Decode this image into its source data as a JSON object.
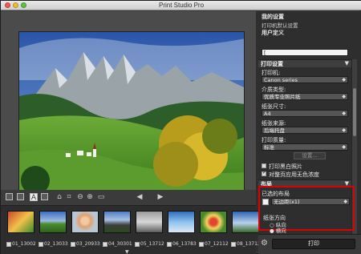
{
  "window": {
    "title": "Print Studio Pro"
  },
  "panel": {
    "my_settings": {
      "header": "我的设置",
      "item_default": "打印机默认设置",
      "item_user": "用户定义",
      "search_value": "["
    },
    "print_settings": {
      "header": "打印设置",
      "printer_label": "打印机:",
      "printer_value": "Canon                    series",
      "media_type_label": "介质类型:",
      "media_type_value": "优质专业照片纸",
      "paper_size_label": "纸张尺寸:",
      "paper_size_value": "A4",
      "paper_source_label": "纸张来源:",
      "paper_source_value": "后端托盘",
      "quality_label": "打印质量:",
      "quality_value": "标准",
      "settings_button": "设置...",
      "bw_print_label": "打印黑白照片",
      "color_correction_label": "对整页应用无色浓度",
      "bw_print_checked": false,
      "color_correction_checked": true
    },
    "layout": {
      "header": "布局",
      "selected_label": "已选的布局",
      "layout_value": "无边距(x1)",
      "orientation_label": "纸张方向",
      "portrait_label": "纵向",
      "landscape_label": "横向",
      "selected_orientation": "landscape"
    },
    "print_button": "打印"
  },
  "thumbnails": [
    {
      "name": "01_13002",
      "checked": true
    },
    {
      "name": "02_13033",
      "checked": true
    },
    {
      "name": "03_20933",
      "checked": true
    },
    {
      "name": "04_30301",
      "checked": true
    },
    {
      "name": "05_13712",
      "checked": true
    },
    {
      "name": "06_13783",
      "checked": true
    },
    {
      "name": "07_12112",
      "checked": true
    },
    {
      "name": "08_13712",
      "checked": true
    }
  ],
  "colors": {
    "accent_highlight": "#e00000",
    "panel_bg": "#2e2e2e",
    "toolbar_bg": "#3b3b3b"
  },
  "icons": {
    "toolbar": [
      "rotate-left-icon",
      "rotate-right-icon",
      "text-icon",
      "rect-icon",
      "crop-icon",
      "zoom-in-icon",
      "zoom-out-icon",
      "fit-icon",
      "prev-icon",
      "next-icon"
    ]
  }
}
